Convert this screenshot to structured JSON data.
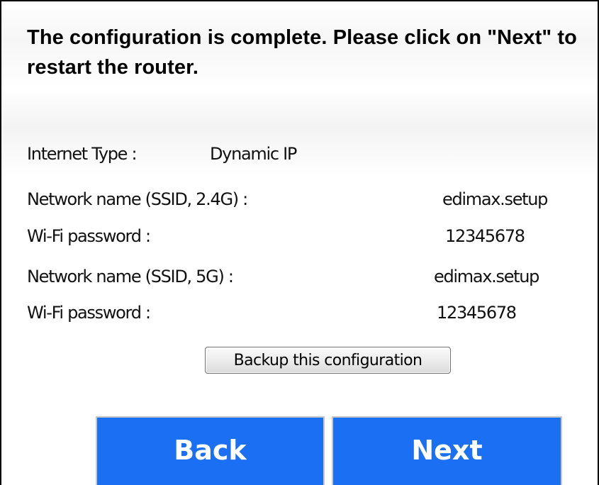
{
  "heading": "The configuration is complete. Please click on \"Next\" to restart the router.",
  "summary": {
    "internet_type": {
      "label": "Internet Type :",
      "value": "Dynamic IP"
    },
    "ssid_24g": {
      "label": "Network name (SSID, 2.4G) :",
      "value": "edimax.setup"
    },
    "password_24g": {
      "label": "Wi-Fi password :",
      "value": "12345678"
    },
    "ssid_5g": {
      "label": "Network name (SSID, 5G) :",
      "value": "edimax.setup"
    },
    "password_5g": {
      "label": "Wi-Fi password :",
      "value": "12345678"
    }
  },
  "buttons": {
    "backup_label": "Backup this configuration",
    "back_label": "Back",
    "next_label": "Next"
  },
  "colors": {
    "nav_button_bg": "#1a6ff2",
    "nav_button_text": "#ffffff"
  }
}
